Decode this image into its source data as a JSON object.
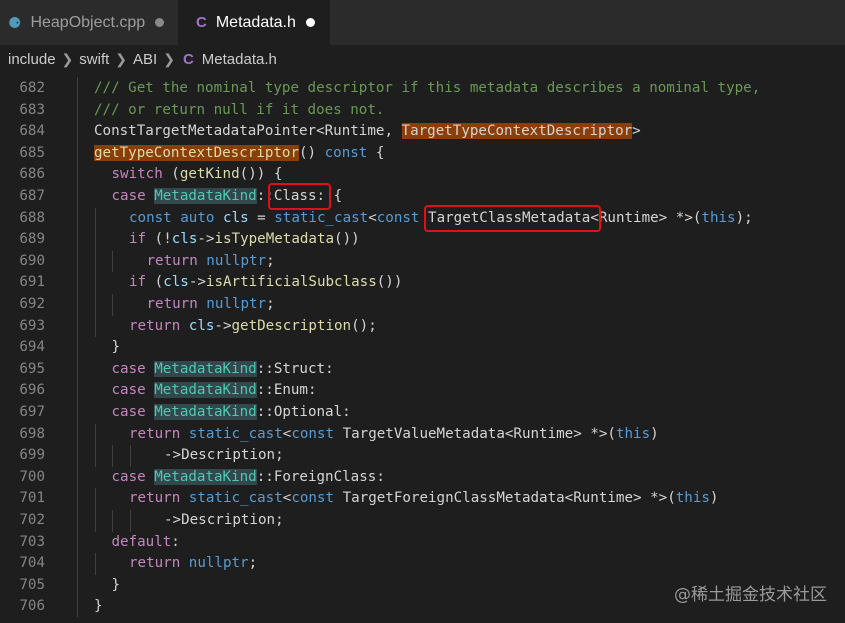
{
  "tabs": [
    {
      "icon": "C++ file icon",
      "label": "HeapObject.cpp",
      "modified": true,
      "active": false
    },
    {
      "icon": "C header icon",
      "label": "Metadata.h",
      "modified": true,
      "active": true
    }
  ],
  "breadcrumb": [
    "include",
    "swift",
    "ABI",
    "Metadata.h"
  ],
  "code_lines": [
    {
      "num": "682",
      "indent": 0,
      "text": "/// Get the nominal type descriptor if this metadata describes a nominal type,"
    },
    {
      "num": "683",
      "indent": 0,
      "text": "/// or return null if it does not."
    },
    {
      "num": "684",
      "indent": 0,
      "text": "ConstTargetMetadataPointer<Runtime, TargetTypeContextDescriptor>"
    },
    {
      "num": "685",
      "indent": 0,
      "text": "getTypeContextDescriptor() const {"
    },
    {
      "num": "686",
      "indent": 1,
      "text": "switch (getKind()) {"
    },
    {
      "num": "687",
      "indent": 1,
      "text": "case MetadataKind::Class: {"
    },
    {
      "num": "688",
      "indent": 2,
      "text": "const auto cls = static_cast<const TargetClassMetadata<Runtime> *>(this);"
    },
    {
      "num": "689",
      "indent": 2,
      "text": "if (!cls->isTypeMetadata())"
    },
    {
      "num": "690",
      "indent": 3,
      "text": "return nullptr;"
    },
    {
      "num": "691",
      "indent": 2,
      "text": "if (cls->isArtificialSubclass())"
    },
    {
      "num": "692",
      "indent": 3,
      "text": "return nullptr;"
    },
    {
      "num": "693",
      "indent": 2,
      "text": "return cls->getDescription();"
    },
    {
      "num": "694",
      "indent": 1,
      "text": "}"
    },
    {
      "num": "695",
      "indent": 1,
      "text": "case MetadataKind::Struct:"
    },
    {
      "num": "696",
      "indent": 1,
      "text": "case MetadataKind::Enum:"
    },
    {
      "num": "697",
      "indent": 1,
      "text": "case MetadataKind::Optional:"
    },
    {
      "num": "698",
      "indent": 2,
      "text": "return static_cast<const TargetValueMetadata<Runtime> *>(this)"
    },
    {
      "num": "699",
      "indent": 4,
      "text": "->Description;"
    },
    {
      "num": "700",
      "indent": 1,
      "text": "case MetadataKind::ForeignClass:"
    },
    {
      "num": "701",
      "indent": 2,
      "text": "return static_cast<const TargetForeignClassMetadata<Runtime> *>(this)"
    },
    {
      "num": "702",
      "indent": 4,
      "text": "->Description;"
    },
    {
      "num": "703",
      "indent": 1,
      "text": "default:"
    },
    {
      "num": "704",
      "indent": 2,
      "text": "return nullptr;"
    },
    {
      "num": "705",
      "indent": 1,
      "text": "}"
    },
    {
      "num": "706",
      "indent": 0,
      "text": "}"
    }
  ],
  "watermark": "@稀土掘金技术社区",
  "colors": {
    "background": "#1e1e1e",
    "comment": "#6a9955",
    "keyword": "#569cd6",
    "type": "#4ec9b0",
    "function": "#dcdcaa",
    "highlight_box": "#e0101a"
  }
}
